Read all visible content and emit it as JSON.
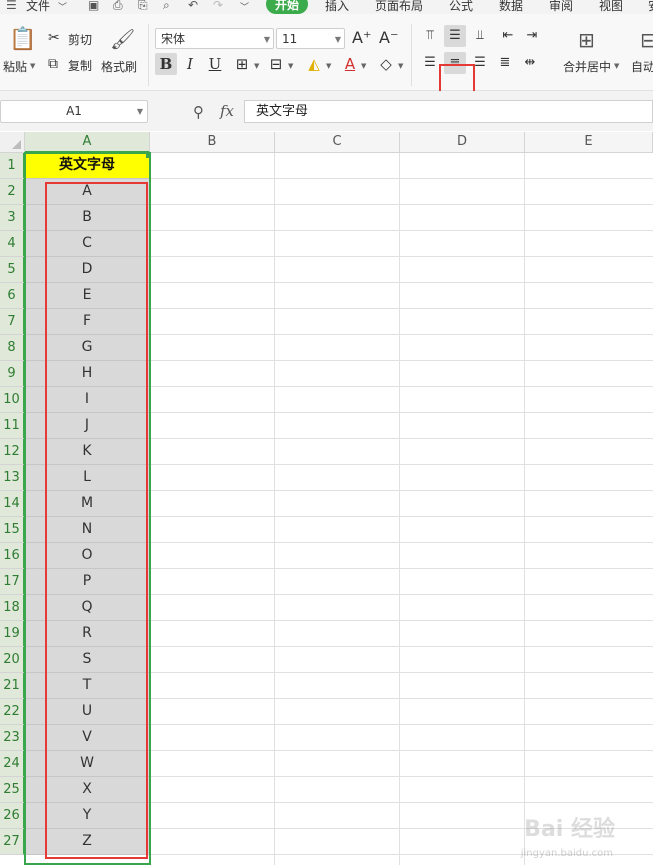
{
  "menu": {
    "file": "文件",
    "tabs": [
      "开始",
      "插入",
      "页面布局",
      "公式",
      "数据",
      "审阅",
      "视图",
      "安"
    ]
  },
  "ribbon": {
    "paste": "粘贴",
    "cut": "剪切",
    "copy": "复制",
    "format_painter": "格式刷",
    "font_name": "宋体",
    "font_size": "11",
    "bold": "B",
    "italic": "I",
    "underline": "U",
    "merge_center": "合并居中",
    "auto_wrap": "自动"
  },
  "formula_bar": {
    "name_box": "A1",
    "fx": "fx",
    "value": "英文字母"
  },
  "columns": [
    "A",
    "B",
    "C",
    "D",
    "E"
  ],
  "rows": [
    "1",
    "2",
    "3",
    "4",
    "5",
    "6",
    "7",
    "8",
    "9",
    "10",
    "11",
    "12",
    "13",
    "14",
    "15",
    "16",
    "17",
    "18",
    "19",
    "20",
    "21",
    "22",
    "23",
    "24",
    "25",
    "26",
    "27"
  ],
  "cells_A": [
    "英文字母",
    "A",
    "B",
    "C",
    "D",
    "E",
    "F",
    "G",
    "H",
    "I",
    "J",
    "K",
    "L",
    "M",
    "N",
    "O",
    "P",
    "Q",
    "R",
    "S",
    "T",
    "U",
    "V",
    "W",
    "X",
    "Y",
    "Z"
  ],
  "colors": {
    "accent": "#3bab4b",
    "header_fill": "#ffff00",
    "selection_fill": "#d9d9d9",
    "highlight_red": "#e53935"
  },
  "watermark": {
    "logo": "Bai 经验",
    "url": "jingyan.baidu.com"
  }
}
